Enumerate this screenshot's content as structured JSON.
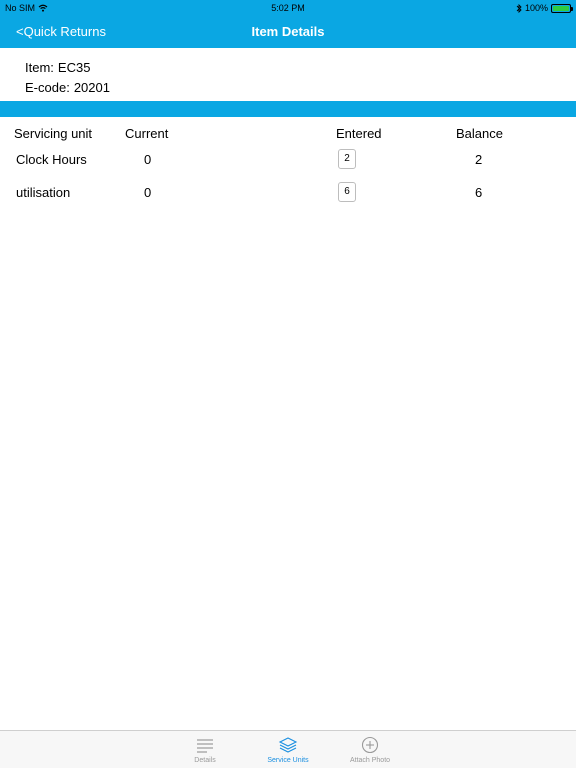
{
  "status_bar": {
    "carrier": "No SIM",
    "time": "5:02 PM",
    "battery": "100%"
  },
  "nav": {
    "back_label": "<Quick Returns",
    "title": "Item Details"
  },
  "item": {
    "item_label": "Item:",
    "item_value": "EC35",
    "ecode_label": "E-code:",
    "ecode_value": "20201"
  },
  "table": {
    "headers": {
      "unit": "Servicing unit",
      "current": "Current",
      "entered": "Entered",
      "balance": "Balance"
    },
    "rows": [
      {
        "unit": "Clock Hours",
        "current": "0",
        "entered": "2",
        "balance": "2"
      },
      {
        "unit": "utilisation",
        "current": "0",
        "entered": "6",
        "balance": "6"
      }
    ]
  },
  "tabs": [
    {
      "label": "Details",
      "icon": "list-icon",
      "active": false
    },
    {
      "label": "Service Units",
      "icon": "layers-icon",
      "active": true
    },
    {
      "label": "Attach Photo",
      "icon": "add-circle-icon",
      "active": false
    }
  ],
  "colors": {
    "accent": "#0aa7e3",
    "active_tab": "#1a8fe0",
    "inactive_tab": "#9a9a9a"
  }
}
